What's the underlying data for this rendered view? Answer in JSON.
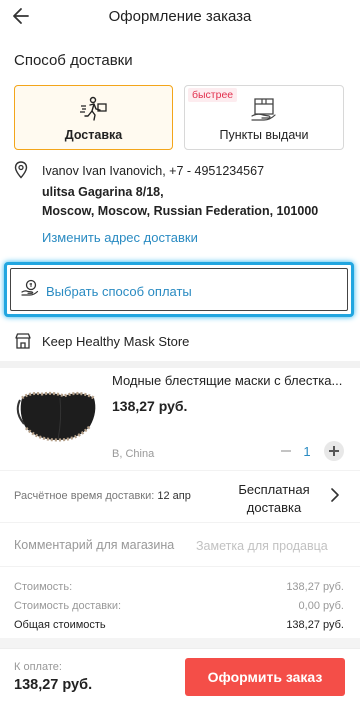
{
  "header": {
    "title": "Оформление заказа",
    "back_icon": "arrow-left-icon"
  },
  "delivery_method": {
    "title": "Способ доставки",
    "options": [
      {
        "label": "Доставка",
        "icon": "courier-icon",
        "selected": true
      },
      {
        "label": "Пункты выдачи",
        "icon": "pickup-box-icon",
        "badge": "быстрее",
        "selected": false
      }
    ]
  },
  "address": {
    "name_phone": "Ivanov Ivan Ivanovich, +7 - 4951234567",
    "street": "ulitsa Gagarina 8/18,",
    "city": "Moscow, Moscow, Russian Federation, 101000",
    "change_link": "Изменить адрес доставки"
  },
  "payment": {
    "label": "Выбрать способ оплаты",
    "icon": "coin-hand-icon"
  },
  "store": {
    "name": "Keep Healthy Mask Store",
    "icon": "store-icon"
  },
  "product": {
    "title": "Модные блестящие маски с блестка...",
    "price": "138,27 руб.",
    "variant": "B, China",
    "quantity": "1"
  },
  "shipping": {
    "time_label": "Расчётное время доставки:",
    "time_value": "12 апр",
    "cost_line1": "Бесплатная",
    "cost_line2": "доставка"
  },
  "comment": {
    "label": "Комментарий для магазина",
    "placeholder": "Заметка для продавца"
  },
  "summary": {
    "cost_label": "Стоимость:",
    "cost_value": "138,27 руб.",
    "delivery_label": "Стоимость доставки:",
    "delivery_value": "0,00 руб.",
    "total_label": "Общая стоимость",
    "total_value": "138,27 руб."
  },
  "footer": {
    "pay_label": "К оплате:",
    "pay_value": "138,27 руб.",
    "order_button": "Оформить заказ"
  },
  "colors": {
    "accent_orange": "#f3a51a",
    "link_blue": "#2a8bc2",
    "highlight_cyan": "#22a6e0",
    "order_red": "#f44e48",
    "badge_red": "#e2304e"
  }
}
